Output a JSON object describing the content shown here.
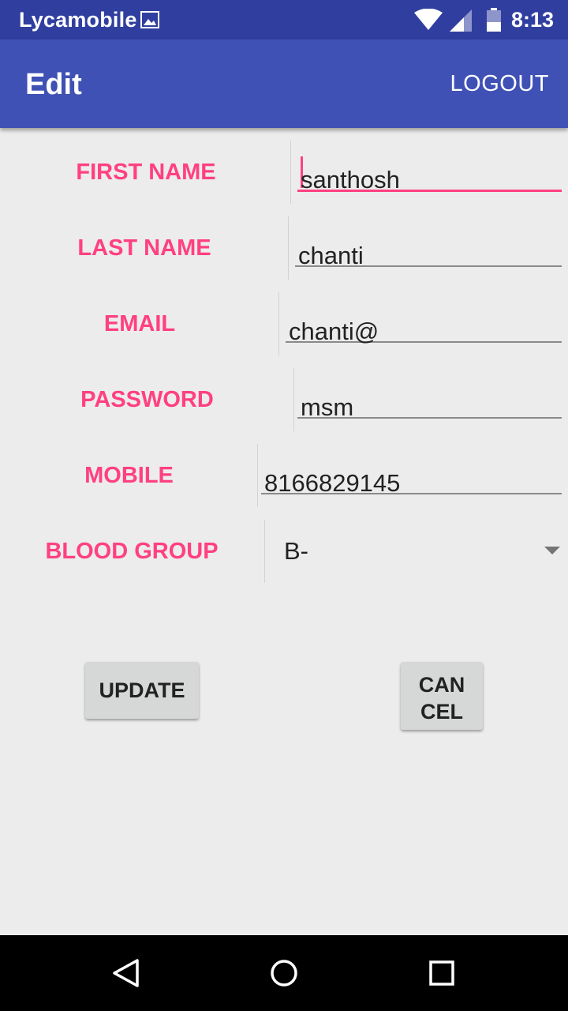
{
  "status_bar": {
    "carrier": "Lycamobile",
    "time": "8:13",
    "icons": [
      "image-icon",
      "wifi-icon",
      "signal-icon",
      "battery-icon"
    ]
  },
  "app_bar": {
    "title": "Edit",
    "logout_label": "LOGOUT"
  },
  "form": {
    "first_name": {
      "label": "FIRST NAME",
      "value": "santhosh"
    },
    "last_name": {
      "label": "LAST NAME",
      "value": "chanti"
    },
    "email": {
      "label": "EMAIL",
      "value": "chanti@"
    },
    "password": {
      "label": "PASSWORD",
      "value": "msm"
    },
    "mobile": {
      "label": "MOBILE",
      "value": "8166829145"
    },
    "blood_group": {
      "label": "BLOOD GROUP",
      "value": "B-"
    }
  },
  "buttons": {
    "update_label": "UPDATE",
    "cancel_line1": "CAN",
    "cancel_line2": "CEL"
  },
  "nav_bar": {
    "icons": [
      "back-icon",
      "home-icon",
      "recents-icon"
    ]
  },
  "colors": {
    "status_bar": "#303f9f",
    "app_bar": "#3f51b5",
    "accent": "#ff4081",
    "background": "#ececec"
  }
}
